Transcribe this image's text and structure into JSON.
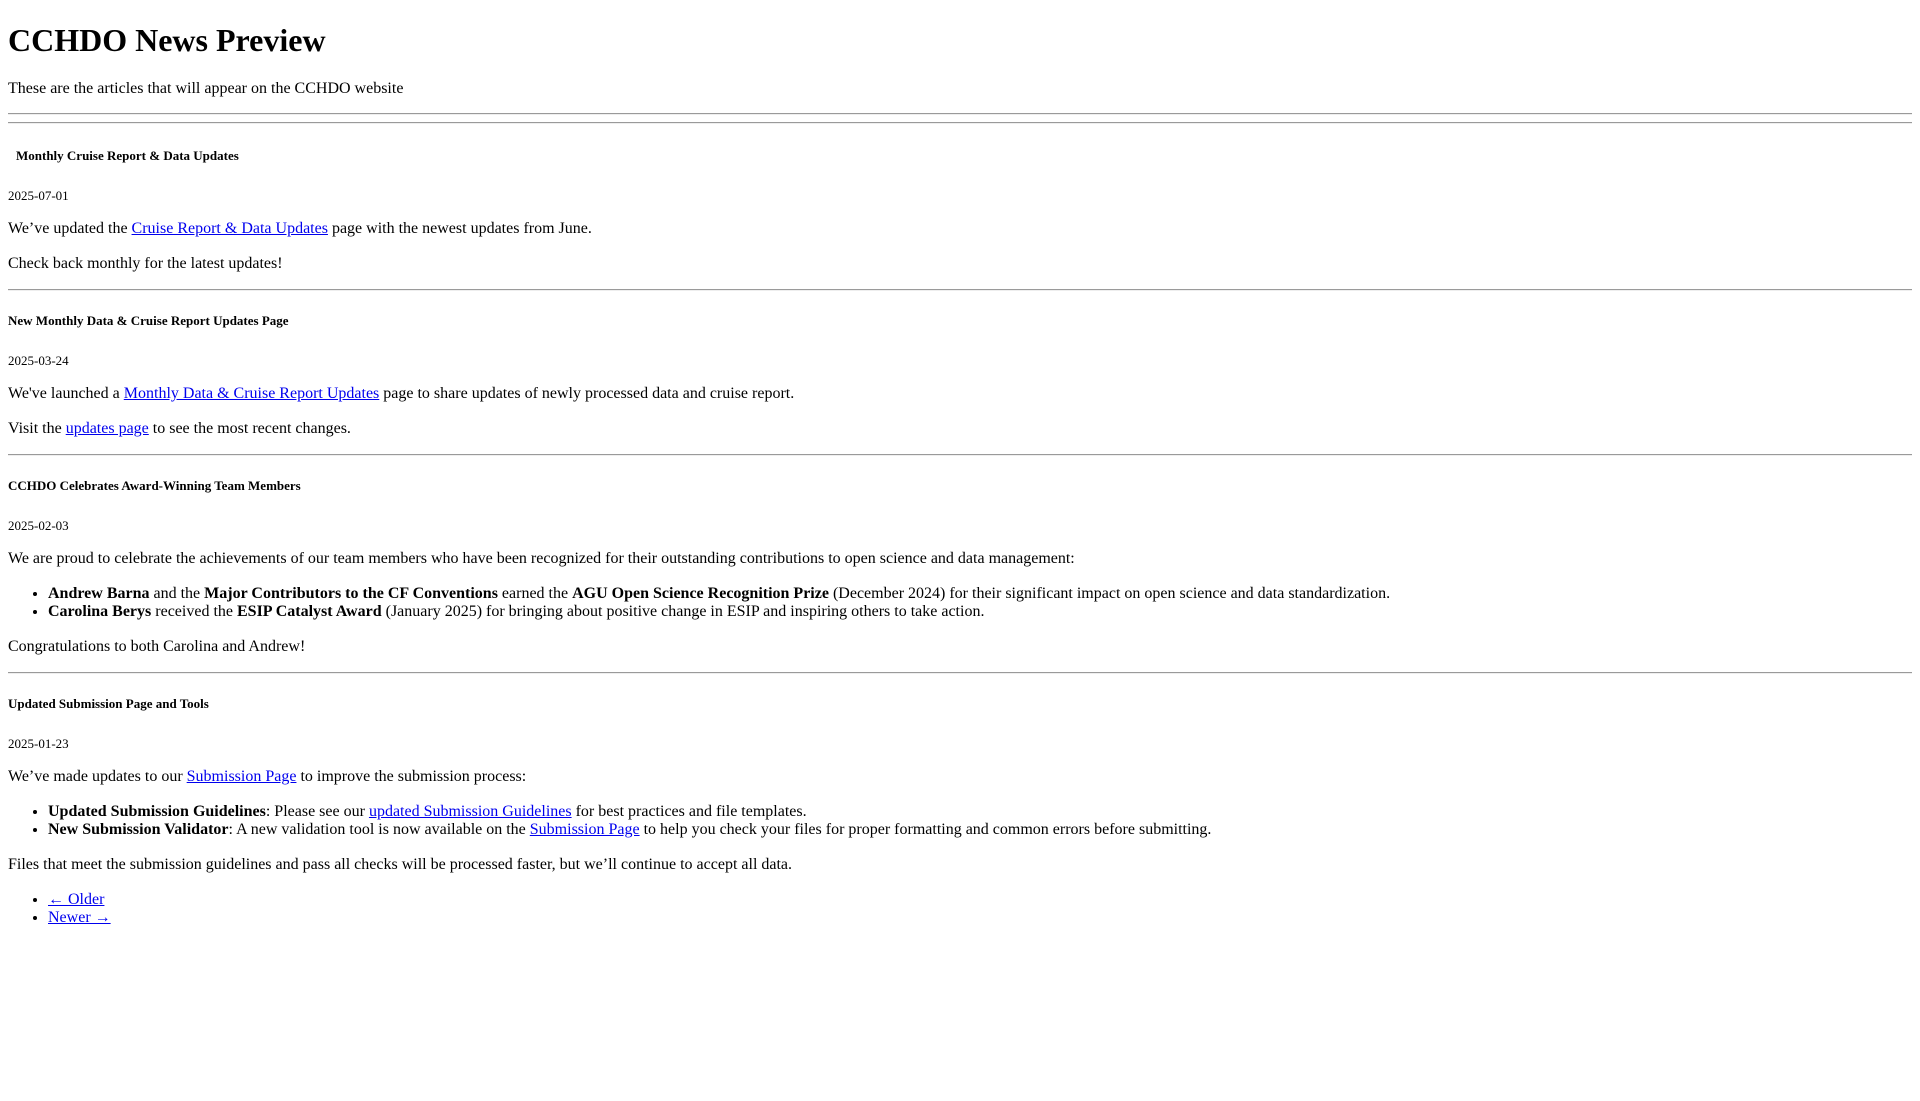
{
  "page": {
    "title": "CCHDO News Preview",
    "subtitle": "These are the articles that will appear on the CCHDO website"
  },
  "articles": [
    {
      "title": "Monthly Cruise Report & Data Updates",
      "date": "2025-07-01",
      "p1": {
        "before": "We’ve updated the ",
        "link": "Cruise Report & Data Updates",
        "after": " page with the newest updates from June."
      },
      "p2": "Check back monthly for the latest updates!"
    },
    {
      "title": "New Monthly Data & Cruise Report Updates Page",
      "date": "2025-03-24",
      "p1": {
        "before": "We've launched a ",
        "link": "Monthly Data & Cruise Report Updates",
        "after": " page to share updates of newly processed data and cruise report."
      },
      "p2": {
        "before": "Visit the ",
        "link": "updates page",
        "after": " to see the most recent changes."
      }
    },
    {
      "title": "CCHDO Celebrates Award-Winning Team Members",
      "date": "2025-02-03",
      "p1": "We are proud to celebrate the achievements of our team members who have been recognized for their outstanding contributions to open science and data management:",
      "items": [
        {
          "name": "Andrew Barna",
          "mid1": " and the ",
          "group": "Major Contributors to the CF Conventions",
          "mid2": " earned the ",
          "award": "AGU Open Science Recognition Prize",
          "after": " (December 2024) for their significant impact on open science and data standardization."
        },
        {
          "name": "Carolina Berys",
          "mid1": " received the ",
          "award": "ESIP Catalyst Award",
          "after": " (January 2025) for bringing about positive change in ESIP and inspiring others to take action."
        }
      ],
      "p2": "Congratulations to both Carolina and Andrew!"
    },
    {
      "title": "Updated Submission Page and Tools",
      "date": "2025-01-23",
      "p1": {
        "before": "We’ve made updates to our ",
        "link": "Submission Page",
        "after": " to improve the submission process:"
      },
      "items": [
        {
          "label": "Updated Submission Guidelines",
          "before": ": Please see our ",
          "link": "updated Submission Guidelines",
          "after": " for best practices and file templates."
        },
        {
          "label": "New Submission Validator",
          "before": ": A new validation tool is now available on the ",
          "link": "Submission Page",
          "after": " to help you check your files for proper formatting and common errors before submitting."
        }
      ],
      "p2": "Files that meet the submission guidelines and pass all checks will be processed faster, but we’ll continue to accept all data."
    }
  ],
  "pager": {
    "older": "← Older",
    "newer": "Newer →"
  }
}
